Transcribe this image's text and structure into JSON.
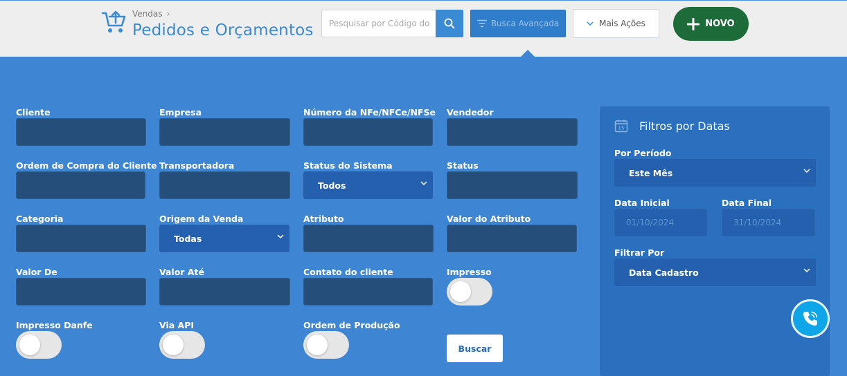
{
  "header": {
    "breadcrumb_parent": "Vendas",
    "title": "Pedidos e Orçamentos",
    "search_placeholder": "Pesquisar por Código do",
    "advanced_search_label": "Busca Avançada",
    "more_actions_label": "Mais Ações",
    "new_label": "NOVO"
  },
  "filters": {
    "cliente": "Cliente",
    "empresa": "Empresa",
    "numero_nfe": "Número da NFe/NFCe/NFSe",
    "vendedor": "Vendedor",
    "ordem_compra": "Ordem de Compra do Cliente",
    "transportadora": "Transportadora",
    "status_sistema": "Status do Sistema",
    "status_sistema_value": "Todos",
    "status": "Status",
    "categoria": "Categoria",
    "origem_venda": "Origem da Venda",
    "origem_venda_value": "Todas",
    "atributo": "Atributo",
    "valor_atributo": "Valor do Atributo",
    "valor_de": "Valor De",
    "valor_ate": "Valor Até",
    "contato_cliente": "Contato do cliente",
    "impresso": "Impresso",
    "impresso_danfe": "Impresso Danfe",
    "via_api": "Via API",
    "ordem_producao": "Ordem de Produção",
    "buscar_label": "Buscar"
  },
  "date_panel": {
    "title": "Filtros por Datas",
    "por_periodo_label": "Por Período",
    "por_periodo_value": "Este Mês",
    "data_inicial_label": "Data Inicial",
    "data_inicial_value": "01/10/2024",
    "data_final_label": "Data Final",
    "data_final_value": "31/10/2024",
    "filtrar_por_label": "Filtrar Por",
    "filtrar_por_value": "Data Cadastro"
  },
  "colors": {
    "background": "#3e86d3",
    "header_bg": "#eeeeee",
    "input_dark": "#264e7a",
    "select_blue": "#2460ae",
    "new_button": "#1e6b3a",
    "phone_button": "#0ea5e9"
  }
}
